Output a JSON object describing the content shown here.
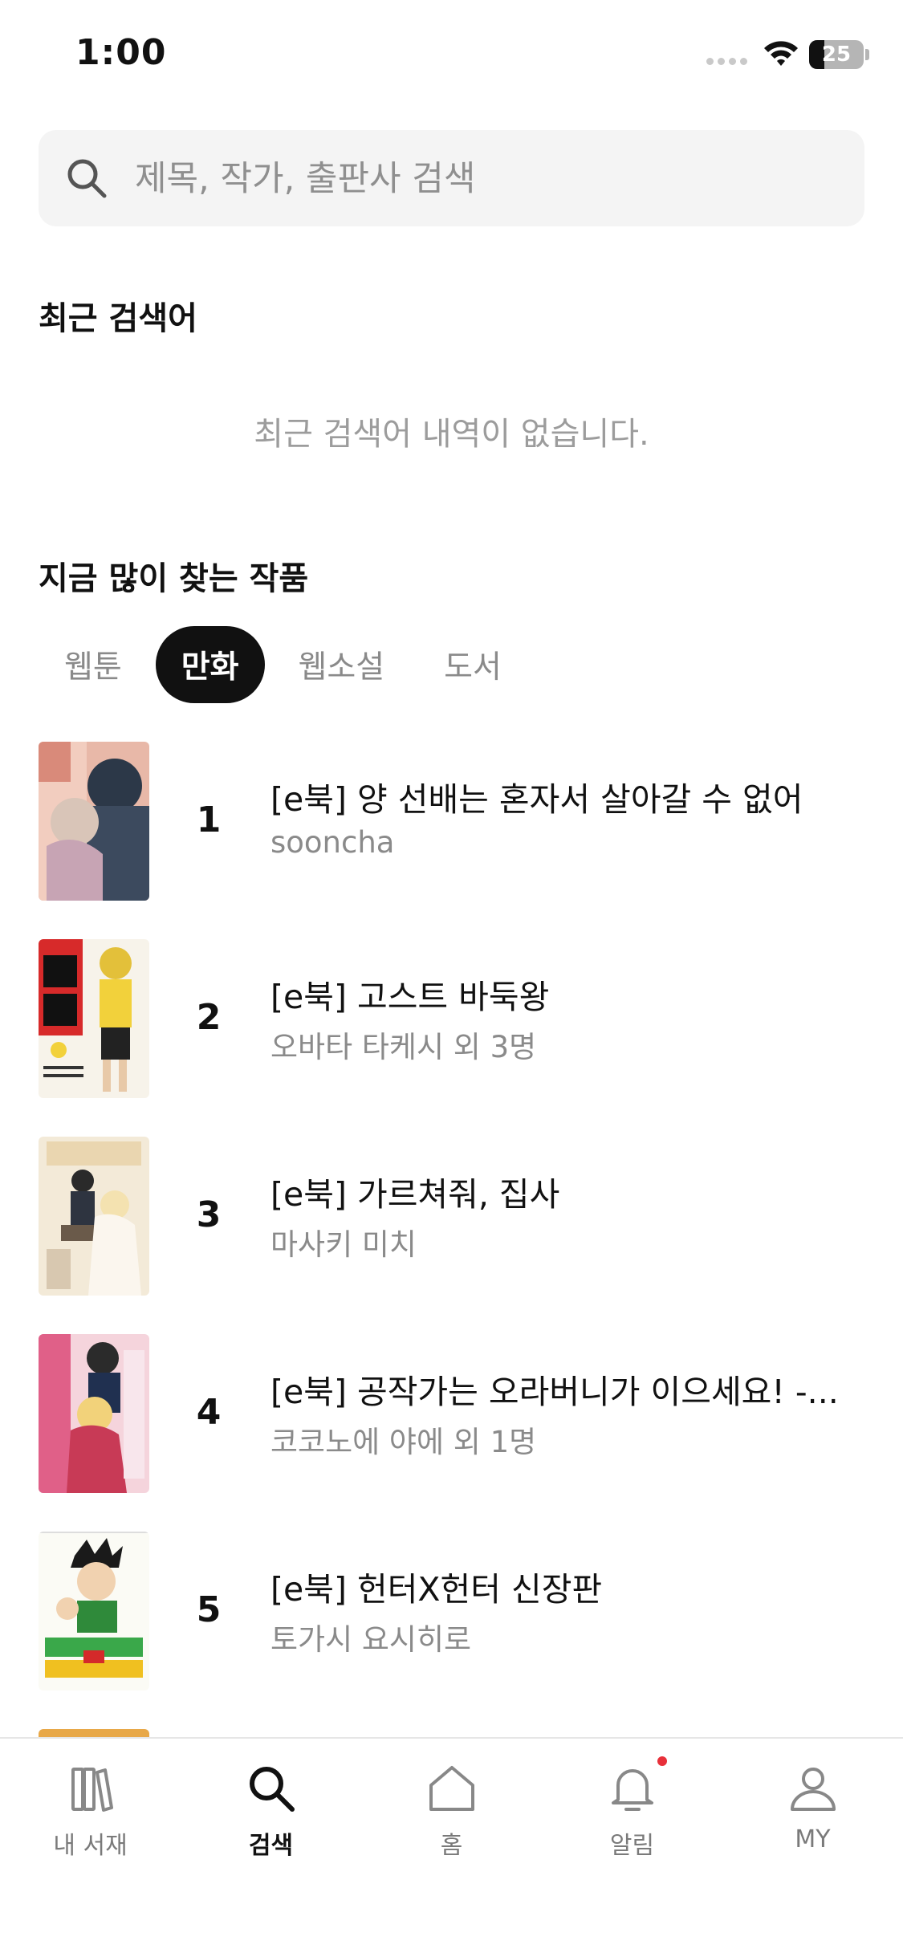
{
  "status_bar": {
    "time": "1:00",
    "battery": "25"
  },
  "search": {
    "placeholder": "제목, 작가, 출판사 검색",
    "value": ""
  },
  "recent": {
    "title": "최근 검색어",
    "empty_message": "최근 검색어 내역이 없습니다."
  },
  "popular": {
    "title": "지금 많이 찾는 작품",
    "tabs": [
      {
        "label": "웹툰",
        "active": false
      },
      {
        "label": "만화",
        "active": true
      },
      {
        "label": "웹소설",
        "active": false
      },
      {
        "label": "도서",
        "active": false
      }
    ],
    "items": [
      {
        "rank": "1",
        "title": "[e북] 양 선배는 혼자서 살아갈 수 없어",
        "author": "sooncha"
      },
      {
        "rank": "2",
        "title": "[e북] 고스트 바둑왕",
        "author": "오바타 타케시 외 3명"
      },
      {
        "rank": "3",
        "title": "[e북] 가르쳐줘, 집사",
        "author": "마사키 미치"
      },
      {
        "rank": "4",
        "title": "[e북] 공작가는 오라버니가 이으세요! -...",
        "author": "코코노에 야에 외 1명"
      },
      {
        "rank": "5",
        "title": "[e북] 헌터X헌터 신장판",
        "author": "토가시 요시히로"
      }
    ]
  },
  "bottom_nav": {
    "items": [
      {
        "label": "내 서재",
        "icon": "library-icon",
        "active": false
      },
      {
        "label": "검색",
        "icon": "search-icon",
        "active": true
      },
      {
        "label": "홈",
        "icon": "home-icon",
        "active": false
      },
      {
        "label": "알림",
        "icon": "bell-icon",
        "active": false,
        "badge": true
      },
      {
        "label": "MY",
        "icon": "person-icon",
        "active": false
      }
    ]
  },
  "colors": {
    "accent": "#111111",
    "badge": "#e8303a",
    "muted": "#8a8a8a"
  }
}
